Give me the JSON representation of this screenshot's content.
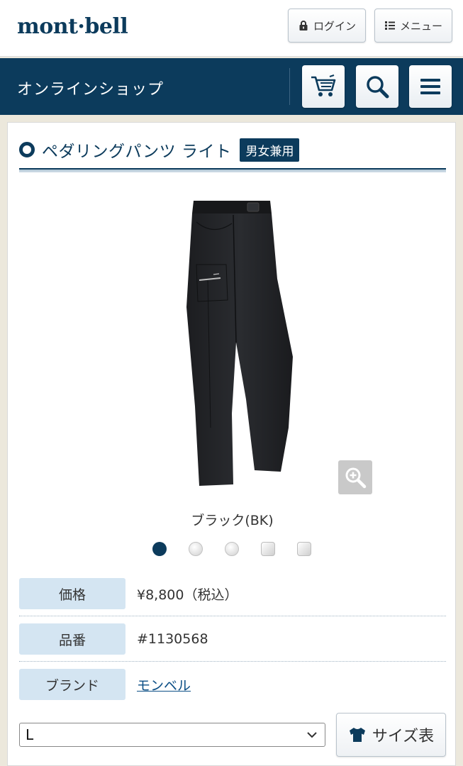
{
  "header": {
    "logo_text": "mont·bell",
    "login_label": "ログイン",
    "menu_label": "メニュー"
  },
  "shopbar": {
    "title": "オンラインショップ",
    "icons": [
      "cart-icon",
      "search-icon",
      "hamburger-icon"
    ]
  },
  "product": {
    "name": "ペダリングパンツ ライト",
    "badge": "男女兼用",
    "color_name": "ブラック(BK)",
    "swatches": [
      {
        "style": "circle",
        "active": true
      },
      {
        "style": "circle",
        "active": false
      },
      {
        "style": "circle",
        "active": false
      },
      {
        "style": "square",
        "active": false
      },
      {
        "style": "square",
        "active": false
      }
    ],
    "specs": {
      "price_label": "価格",
      "price_value": "¥8,800（税込）",
      "code_label": "品番",
      "code_value": "#1130568",
      "brand_label": "ブランド",
      "brand_value": "モンベル"
    },
    "size": {
      "selected": "L",
      "chart_label": "サイズ表"
    }
  },
  "colors": {
    "navy": "#0c3b5c",
    "spec_label_bg": "#d4e5f2",
    "page_bg": "#ece8dc"
  }
}
